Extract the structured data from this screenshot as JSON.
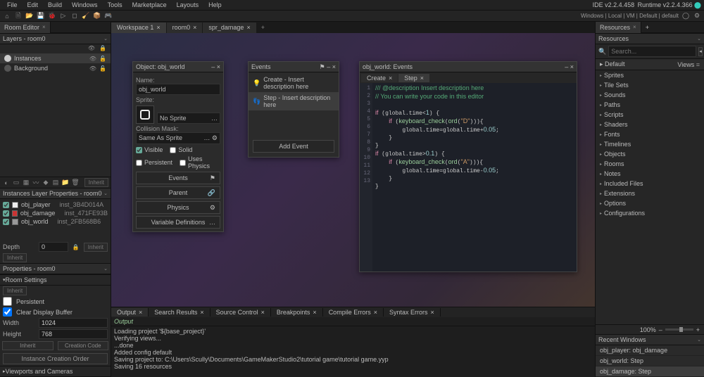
{
  "menubar": [
    "File",
    "Edit",
    "Build",
    "Windows",
    "Tools",
    "Marketplace",
    "Layouts",
    "Help"
  ],
  "ide_version_left": "IDE v2.2.4.458",
  "ide_version_right": "Runtime v2.2.4.366",
  "toolbar_status": "Windows | Local | VM | Default | default",
  "left": {
    "room_editor_tab": "Room Editor",
    "layers_head": "Layers - room0",
    "layers": [
      {
        "name": "Instances",
        "selected": true
      },
      {
        "name": "Background",
        "selected": false
      }
    ],
    "layer_tb_inherit": "Inherit",
    "inst_props_head": "Instances Layer Properties - room0",
    "instances": [
      {
        "obj": "obj_player",
        "inst": "inst_3B4D014A",
        "color": "white"
      },
      {
        "obj": "obj_damage",
        "inst": "inst_471FE93B",
        "color": "red"
      },
      {
        "obj": "obj_world",
        "inst": "inst_2FB568B6",
        "color": "gray"
      }
    ],
    "depth_lbl": "Depth",
    "depth_val": "0",
    "inherit": "Inherit",
    "props_head": "Properties - room0",
    "room_settings": "Room Settings",
    "persistent": "Persistent",
    "clear_display": "Clear Display Buffer",
    "width_lbl": "Width",
    "width_val": "1024",
    "height_lbl": "Height",
    "height_val": "768",
    "creation_code": "Creation Code",
    "inst_creation_order": "Instance Creation Order",
    "viewports_cameras": "Viewports and Cameras"
  },
  "workspace": {
    "tabs": [
      {
        "label": "Workspace 1",
        "active": true
      },
      {
        "label": "room0",
        "active": false
      },
      {
        "label": "spr_damage",
        "active": false
      }
    ]
  },
  "obj_panel": {
    "title": "Object: obj_world",
    "name_lbl": "Name:",
    "name_val": "obj_world",
    "sprite_lbl": "Sprite:",
    "no_sprite": "No Sprite",
    "coll_lbl": "Collision Mask:",
    "coll_val": "Same As Sprite",
    "visible": "Visible",
    "solid": "Solid",
    "persistent": "Persistent",
    "uses_physics": "Uses Physics",
    "events": "Events",
    "parent": "Parent",
    "physics": "Physics",
    "vardefs": "Variable Definitions"
  },
  "ev_panel": {
    "title": "Events",
    "items": [
      {
        "icon": "create",
        "text": "Create - Insert description here",
        "sel": false
      },
      {
        "icon": "step",
        "text": "Step - Insert description here",
        "sel": true
      }
    ],
    "add": "Add Event"
  },
  "code_panel": {
    "title": "obj_world: Events",
    "tabs": [
      {
        "label": "Create",
        "active": false
      },
      {
        "label": "Step",
        "active": true
      }
    ],
    "lines": [
      "/// @description Insert description here",
      "// You can write your code in this editor",
      "",
      "if (global.time<1) {",
      "    if (keyboard_check(ord(\"D\"))){",
      "        global.time=global.time+0.05;",
      "    }",
      "}",
      "if (global.time>0.1) {",
      "    if (keyboard_check(ord(\"A\"))){",
      "        global.time=global.time-0.05;",
      "    }",
      "}"
    ]
  },
  "output": {
    "tabs": [
      "Output",
      "Search Results",
      "Source Control",
      "Breakpoints",
      "Compile Errors",
      "Syntax Errors"
    ],
    "head": "Output",
    "lines": [
      "Loading project '${base_project}'",
      "Verifying views...",
      "...done",
      "Added config default",
      "Saving project to: C:\\Users\\Scully\\Documents\\GameMakerStudio2\\tutorial game\\tutorial game.yyp",
      "Saving 16 resources"
    ]
  },
  "right": {
    "resources_tab": "Resources",
    "resources_head": "Resources",
    "search_ph": "Search...",
    "default": "Default",
    "views": "Views",
    "groups": [
      "Sprites",
      "Tile Sets",
      "Sounds",
      "Paths",
      "Scripts",
      "Shaders",
      "Fonts",
      "Timelines",
      "Objects",
      "Rooms",
      "Notes",
      "Included Files",
      "Extensions",
      "Options",
      "Configurations"
    ],
    "zoom": "100%",
    "recent_head": "Recent Windows",
    "recent": [
      "obj_player: obj_damage",
      "obj_world: Step",
      "obj_damage: Step"
    ]
  }
}
